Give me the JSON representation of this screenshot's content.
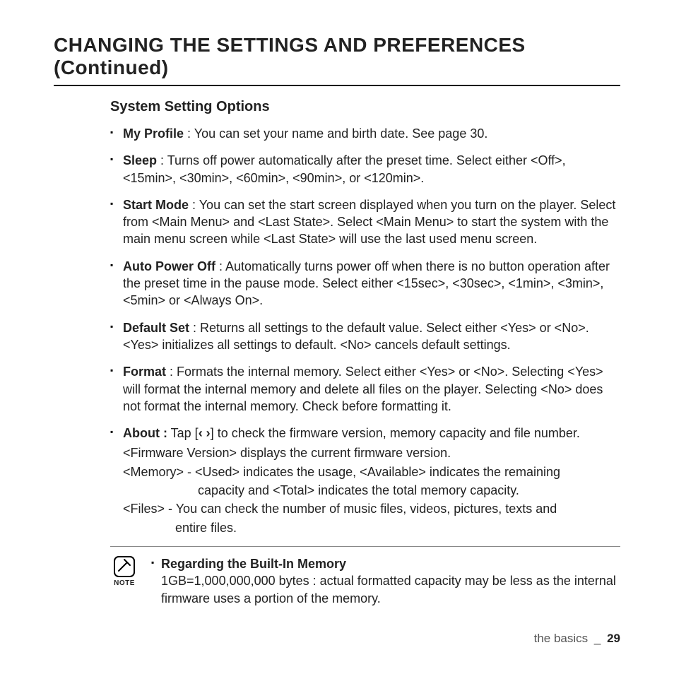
{
  "title": "CHANGING THE SETTINGS AND PREFERENCES (Continued)",
  "subhead": "System Setting Options",
  "options": [
    {
      "name": "My Profile",
      "sep": " : ",
      "desc": "You can set your name and birth date. See page 30."
    },
    {
      "name": "Sleep",
      "sep": " : ",
      "desc": "Turns off power automatically after the preset time. Select either <Off>, <15min>, <30min>, <60min>, <90min>, or <120min>."
    },
    {
      "name": "Start Mode",
      "sep": " : ",
      "desc": "You can set the start screen displayed when you turn on the player. Select from <Main Menu> and <Last State>. Select <Main Menu> to start the system with the main menu screen while <Last State> will use the last used menu screen."
    },
    {
      "name": "Auto Power Off",
      "sep": " : ",
      "desc": "Automatically turns power off when there is no button operation after the preset time in the pause mode. Select either <15sec>, <30sec>, <1min>, <3min>, <5min> or <Always On>."
    },
    {
      "name": "Default Set",
      "sep": " : ",
      "desc": "Returns all settings to the default value. Select either <Yes> or <No>. <Yes> initializes all settings to default. <No> cancels default settings."
    },
    {
      "name": "Format",
      "sep": " : ",
      "desc": "Formats the internal memory. Select either <Yes> or <No>. Selecting <Yes> will format the internal memory and delete all files on the player. Selecting <No> does not format the internal memory. Check before formatting it."
    }
  ],
  "about": {
    "name": "About :",
    "lead_a": " Tap [",
    "nav": "‹  ›",
    "lead_b": "] to check the firmware version, memory capacity and file number.",
    "line1": "<Firmware Version> displays the current firmware version.",
    "line2a": "<Memory> - <Used> indicates the usage, <Available> indicates the remaining",
    "line2b": "capacity and <Total> indicates the total memory capacity.",
    "line3a": "<Files> - You can check the number of music files, videos, pictures, texts and",
    "line3b": "entire files."
  },
  "note": {
    "label": "NOTE",
    "title": "Regarding the Built-In Memory",
    "body": "1GB=1,000,000,000 bytes : actual formatted capacity may be less as the internal firmware uses a portion of the memory."
  },
  "footer": {
    "section": "the basics",
    "sep": "_",
    "page": "29"
  }
}
